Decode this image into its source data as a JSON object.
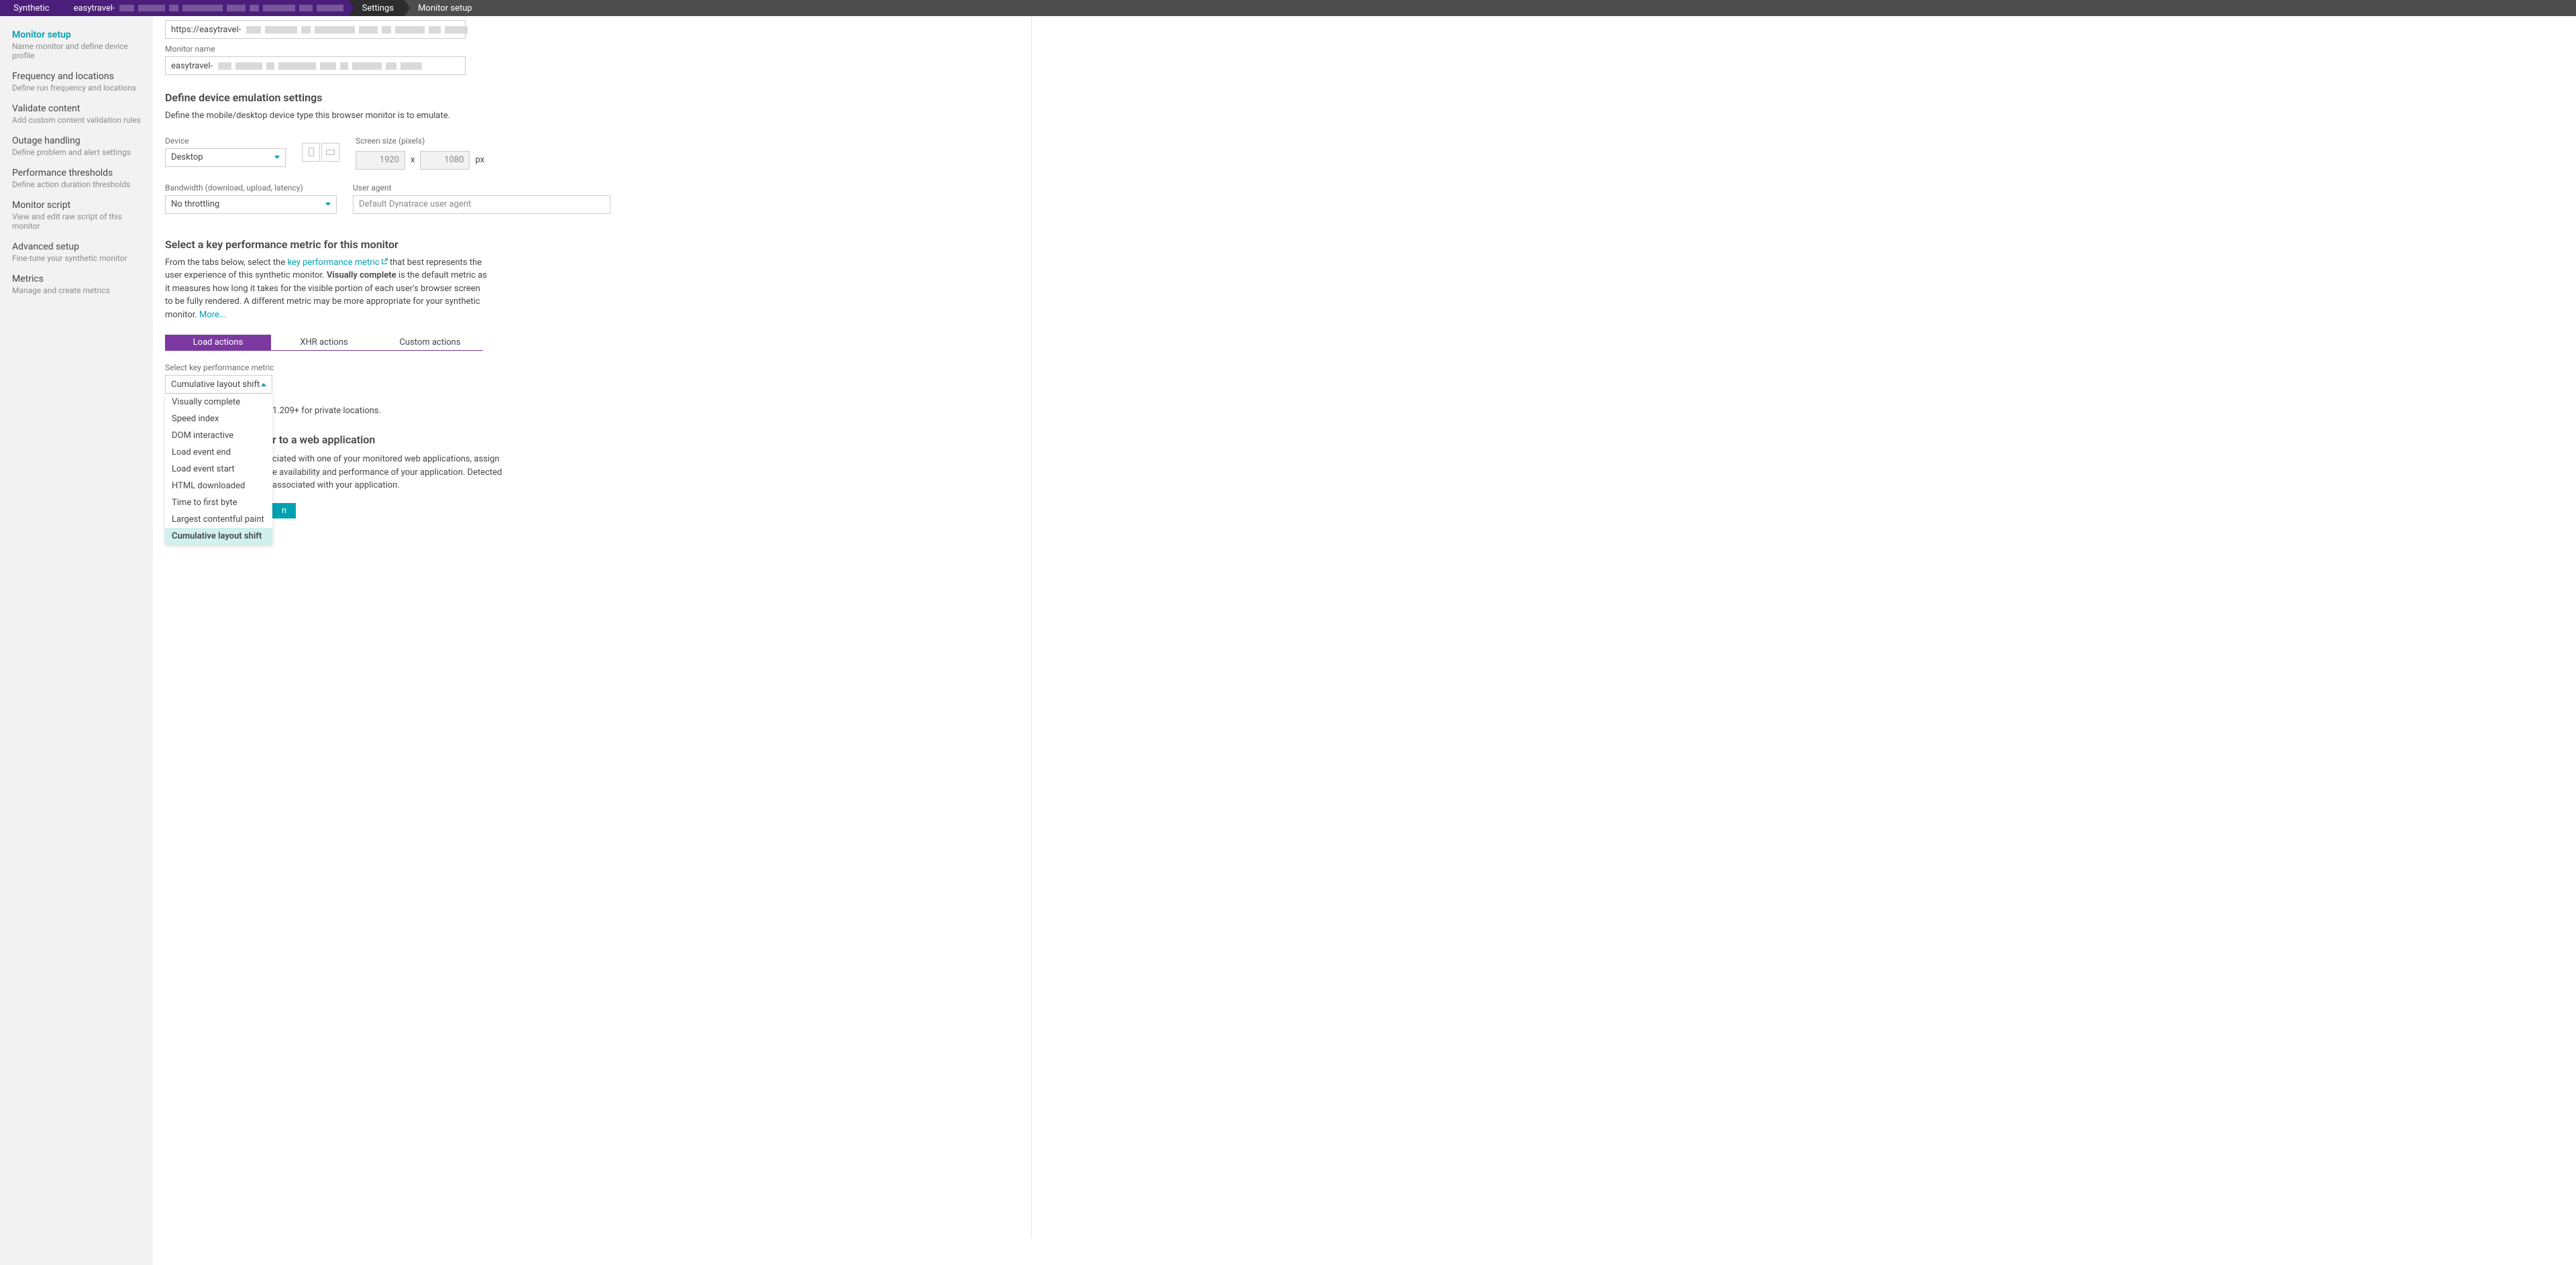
{
  "breadcrumb": {
    "items": [
      "Synthetic",
      "easytravel-",
      "Settings",
      "Monitor setup"
    ]
  },
  "sidebar": {
    "items": [
      {
        "title": "Monitor setup",
        "sub": "Name monitor and define device profile"
      },
      {
        "title": "Frequency and locations",
        "sub": "Define run frequency and locations"
      },
      {
        "title": "Validate content",
        "sub": "Add custom content validation rules"
      },
      {
        "title": "Outage handling",
        "sub": "Define problem and alert settings"
      },
      {
        "title": "Performance thresholds",
        "sub": "Define action duration thresholds"
      },
      {
        "title": "Monitor script",
        "sub": "View and edit raw script of this monitor"
      },
      {
        "title": "Advanced setup",
        "sub": "Fine-tune your synthetic monitor"
      },
      {
        "title": "Metrics",
        "sub": "Manage and create metrics"
      }
    ]
  },
  "form": {
    "url_prefix": "https://easytravel-",
    "monitor_name_label": "Monitor name",
    "monitor_name_prefix": "easytravel-",
    "device_section": {
      "heading": "Define device emulation settings",
      "body": "Define the mobile/desktop device type this browser monitor is to emulate.",
      "device_label": "Device",
      "device_value": "Desktop",
      "screen_label": "Screen size (pixels)",
      "width": "1920",
      "height": "1080",
      "x": "x",
      "px": "px",
      "bandwidth_label": "Bandwidth (download, upload, latency)",
      "bandwidth_value": "No throttling",
      "ua_label": "User agent",
      "ua_placeholder": "Default Dynatrace user agent"
    },
    "kpm_section": {
      "heading": "Select a key performance metric for this monitor",
      "body_pre": "From the tabs below, select the ",
      "link_text": "key performance metric",
      "body_mid": " that best represents the user experience of this synthetic monitor. ",
      "strong": "Visually complete",
      "body_post": " is the default metric as it measures how long it takes for the visible portion of each user's browser screen to be fully rendered. A different metric may be more appropriate for your synthetic monitor. ",
      "more": "More...",
      "tabs": [
        "Load actions",
        "XHR actions",
        "Custom actions"
      ],
      "select_label": "Select key performance metric",
      "selected": "Cumulative layout shift",
      "options": [
        "Visually complete",
        "Speed index",
        "DOM interactive",
        "Load event end",
        "Load event start",
        "HTML downloaded",
        "Time to first byte",
        "Largest contentful paint",
        "Cumulative layout shift"
      ],
      "note_suffix": " 1.209+ for private locations."
    },
    "link_section": {
      "heading_suffix": "r to a web application",
      "body_suffix_1": "ciated with one of your monitored web applications, assign",
      "body_suffix_2": "e availability and performance of your application. Detected",
      "body_suffix_3": "associated with your application.",
      "button_suffix": "n"
    }
  }
}
